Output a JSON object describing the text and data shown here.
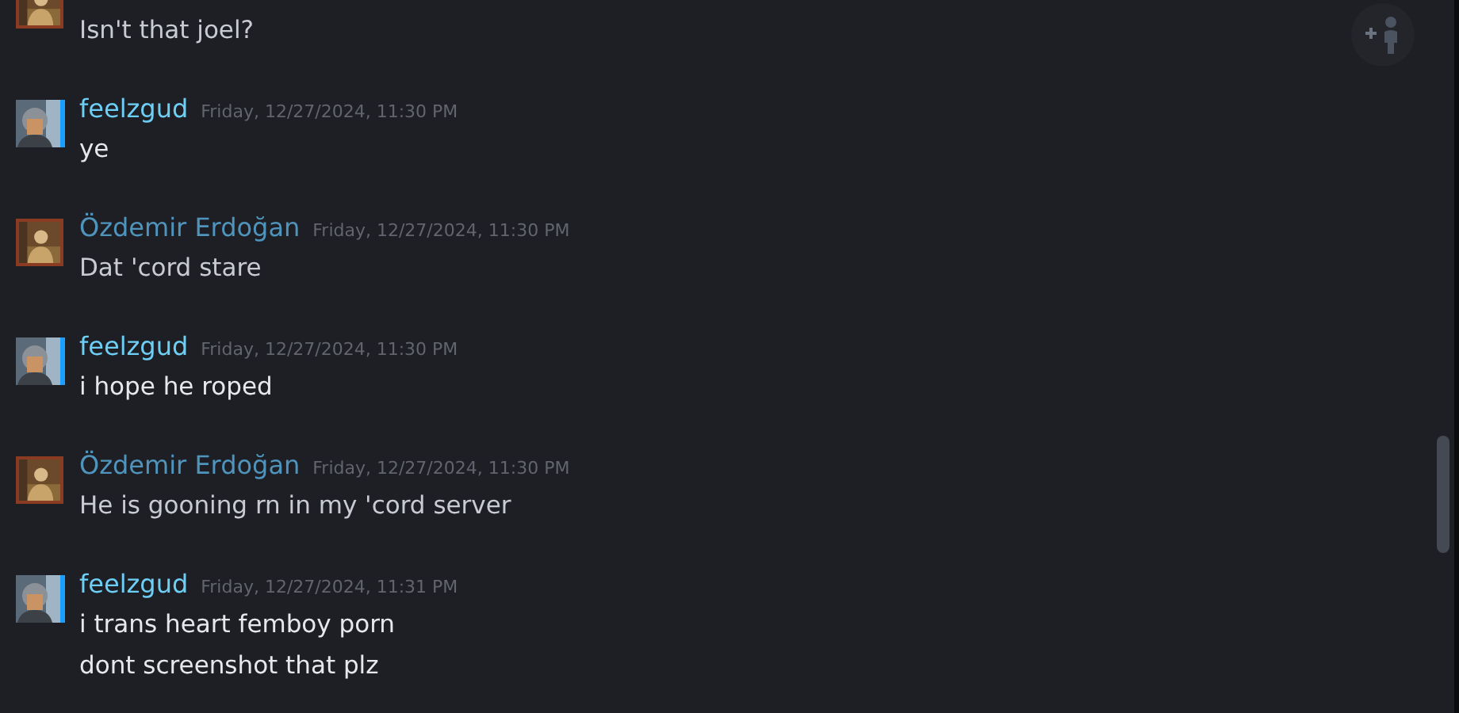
{
  "messages": [
    {
      "kind": "friend",
      "lines": [
        "Isn't that joel?"
      ]
    },
    {
      "kind": "self",
      "author": "feelzgud",
      "time": "Friday, 12/27/2024, 11:30 PM",
      "lines": [
        "ye"
      ]
    },
    {
      "kind": "friend",
      "author": "Özdemir Erdoğan",
      "time": "Friday, 12/27/2024, 11:30 PM",
      "lines": [
        "Dat 'cord stare"
      ]
    },
    {
      "kind": "self",
      "author": "feelzgud",
      "time": "Friday, 12/27/2024, 11:30 PM",
      "lines": [
        "i hope he roped"
      ]
    },
    {
      "kind": "friend",
      "author": "Özdemir Erdoğan",
      "time": "Friday, 12/27/2024, 11:30 PM",
      "lines": [
        "He is gooning rn in my 'cord server"
      ]
    },
    {
      "kind": "self",
      "author": "feelzgud",
      "time": "Friday, 12/27/2024, 11:31 PM",
      "lines": [
        "i trans heart femboy porn",
        "dont screenshot that plz"
      ]
    }
  ]
}
